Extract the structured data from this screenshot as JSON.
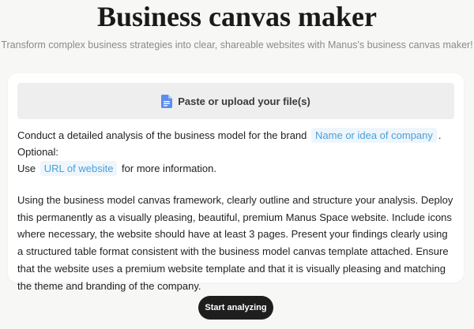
{
  "header": {
    "title": "Business canvas maker",
    "subtitle": "Transform complex business strategies into clear, shareable websites with Manus's business canvas maker!"
  },
  "upload": {
    "label": "Paste or upload your file(s)",
    "icon": "document-icon",
    "icon_color": "#5b8def"
  },
  "prompt": {
    "line1_before": "Conduct a detailed analysis of the business model for the brand",
    "company_placeholder": "Name or idea of company",
    "line1_after": ". Optional:",
    "line2_before": "Use",
    "website_placeholder": "URL of website",
    "line2_after": "for more information.",
    "paragraph2": "Using the business model canvas framework, clearly outline and structure your analysis. Deploy this permanently as a visually pleasing, beautiful, premium Manus Space website. Include icons where necessary, the website should have at least 3 pages. Present your findings clearly using a structured table format consistent with the business model canvas template attached. Ensure that the website uses a premium website template and that it is visually pleasing and matching the theme and branding of the company."
  },
  "actions": {
    "start_label": "Start analyzing"
  },
  "colors": {
    "background": "#f7f7f5",
    "card": "#ffffff",
    "upload_bg": "#eeeeee",
    "chip_bg": "#eef6fc",
    "chip_text": "#4a9fd8",
    "button_bg": "#1e1e1e"
  }
}
